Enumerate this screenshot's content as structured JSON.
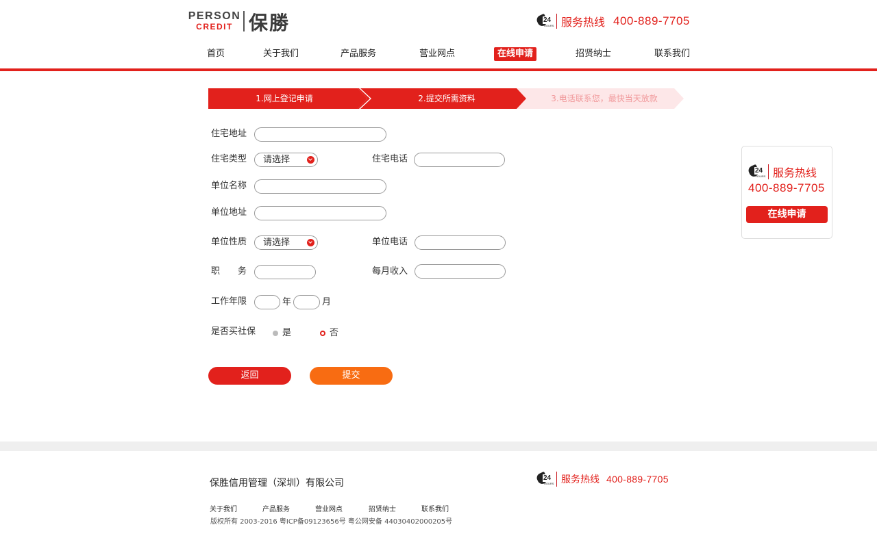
{
  "header": {
    "logo_en_line1": "PERSON",
    "logo_en_line2": "CREDIT",
    "logo_cn": "保勝",
    "hotline_icon": "phone-24h-icon",
    "hotline_label": "服务热线",
    "hotline_number": "400-889-7705"
  },
  "nav": {
    "items": [
      "首页",
      "关于我们",
      "产品服务",
      "营业网点",
      "在线申请",
      "招贤纳士",
      "联系我们"
    ],
    "active_index": 4
  },
  "steps": {
    "step1": "1.网上登记申请",
    "step2": "2.提交所需资料",
    "step3": "3.电话联系您，最快当天放款"
  },
  "form": {
    "residence_address": {
      "label": "住宅地址",
      "value": ""
    },
    "residence_type": {
      "label": "住宅类型",
      "value": "请选择"
    },
    "residence_phone": {
      "label": "住宅电话",
      "value": ""
    },
    "company_name": {
      "label": "单位名称",
      "value": ""
    },
    "company_address": {
      "label": "单位地址",
      "value": ""
    },
    "company_nature": {
      "label": "单位性质",
      "value": "请选择"
    },
    "company_phone": {
      "label": "单位电话",
      "value": ""
    },
    "position": {
      "label": "职　　务",
      "value": ""
    },
    "monthly_income": {
      "label": "每月收入",
      "value": ""
    },
    "work_years": {
      "label": "工作年限",
      "year_unit": "年",
      "month_unit": "月",
      "years": "",
      "months": ""
    },
    "social_security": {
      "label": "是否买社保",
      "option_yes": "是",
      "option_no": "否",
      "selected": "否"
    }
  },
  "buttons": {
    "back": "返回",
    "submit": "提交"
  },
  "side_widget": {
    "hotline_label": "服务热线",
    "hotline_number": "400-889-7705",
    "apply_button": "在线申请"
  },
  "footer": {
    "company": "保胜信用管理（深圳）有限公司",
    "hotline_label": "服务热线",
    "hotline_number": "400-889-7705",
    "links": [
      "关于我们",
      "产品服务",
      "营业网点",
      "招贤纳士",
      "联系我们"
    ],
    "copyright": "版权所有 2003-2016 粤ICP备09123656号 粤公网安备 44030402000205号"
  },
  "colors": {
    "brand_red": "#e2211c",
    "submit_orange": "#f86c12",
    "step_inactive_bg": "#fde7e8",
    "step_inactive_text": "#f19a9c"
  }
}
